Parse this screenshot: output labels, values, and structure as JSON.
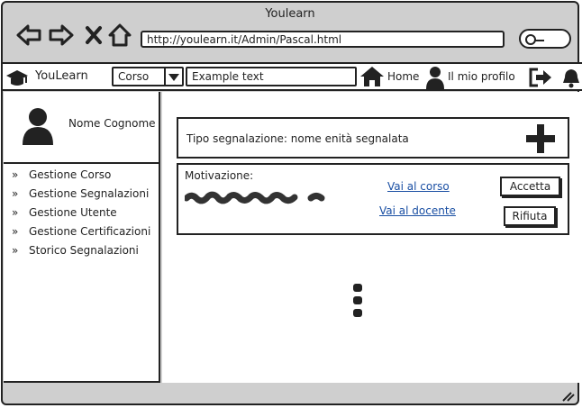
{
  "browser": {
    "title": "Youlearn",
    "url": "http://youlearn.it/Admin/Pascal.html"
  },
  "appbar": {
    "brand": "YouLearn",
    "category_select": "Corso",
    "search_text": "Example text",
    "home_label": "Home",
    "profile_label": "Il mio profilo"
  },
  "sidebar": {
    "user_name": "Nome Cognome",
    "items": [
      {
        "label": "Gestione Corso"
      },
      {
        "label": "Gestione Segnalazioni"
      },
      {
        "label": "Gestione Utente"
      },
      {
        "label": "Gestione Certificazioni"
      },
      {
        "label": "Storico Segnalazioni"
      }
    ]
  },
  "report": {
    "header": "Tipo segnalazione: nome enità segnalata",
    "reason_label": "Motivazione:",
    "link_course": "Vai al corso",
    "link_teacher": "Vai al docente",
    "accept": "Accetta",
    "reject": "Rifiuta"
  }
}
